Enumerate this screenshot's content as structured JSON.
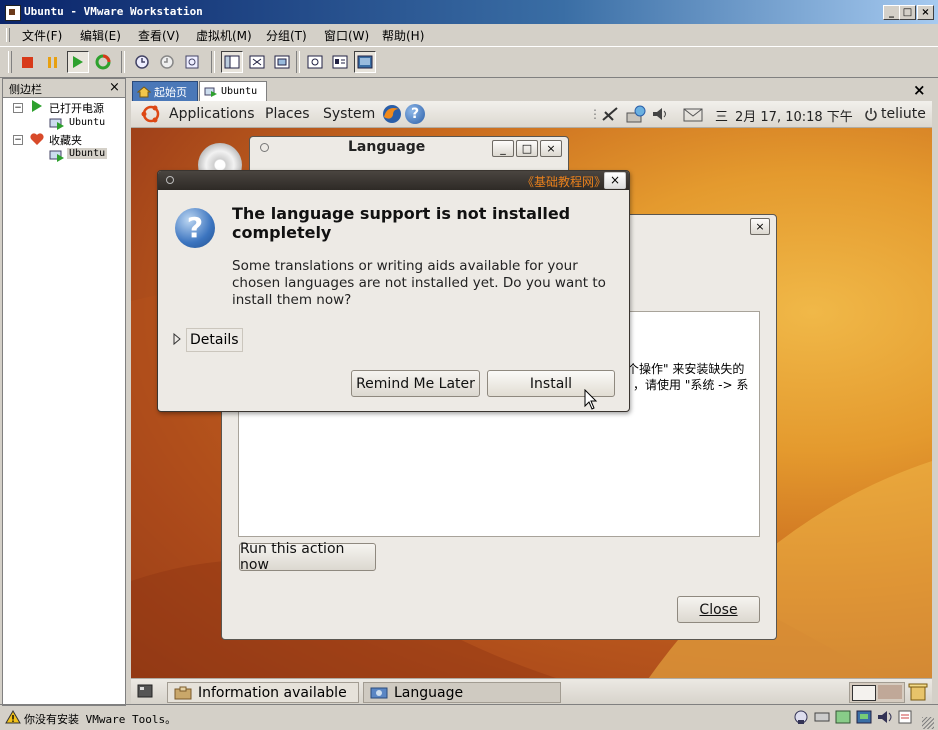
{
  "window": {
    "title": "Ubuntu - VMware Workstation",
    "min": "_",
    "max": "□",
    "close": "×"
  },
  "menu": [
    {
      "label": "文件(F)"
    },
    {
      "label": "编辑(E)"
    },
    {
      "label": "查看(V)"
    },
    {
      "label": "虚拟机(M)"
    },
    {
      "label": "分组(T)"
    },
    {
      "label": "窗口(W)"
    },
    {
      "label": "帮助(H)"
    }
  ],
  "sidebar": {
    "title": "侧边栏",
    "close": "×",
    "groups": [
      {
        "label": "已打开电源",
        "child": "Ubuntu"
      },
      {
        "label": "收藏夹",
        "child": "Ubuntu"
      }
    ]
  },
  "tabs": [
    {
      "label": "起始页"
    },
    {
      "label": "Ubuntu"
    }
  ],
  "tabs_close": "×",
  "guest": {
    "panel": {
      "applications": "Applications",
      "places": "Places",
      "system": "System",
      "help_glyph": "?",
      "weekday": "三",
      "datetime": "2月 17, 10:18 下午",
      "user": "teliute"
    },
    "language_window": {
      "title": "Language",
      "min": "_",
      "max": "□",
      "close": "×",
      "back_close": "×",
      "text_line1": "个操作\" 来安装缺失的",
      "text_line2": "，请使用 \"系统 -> 系",
      "run_button": "Run this action now",
      "close_button": "Close"
    },
    "alert": {
      "watermark": "《基础教程网》",
      "close": "×",
      "icon_glyph": "?",
      "heading": "The language support is not installed completely",
      "body": "Some translations or writing aids available for your chosen languages are not installed yet. Do you want to install them now?",
      "details": "Details",
      "remind_button": "Remind Me Later",
      "install_button": "Install"
    },
    "taskbar": [
      {
        "label": "Information available"
      },
      {
        "label": "Language"
      }
    ]
  },
  "status": {
    "message": "你没有安装 VMware Tools。"
  },
  "colors": {
    "title_gradient_start": "#0a246a",
    "title_gradient_end": "#a6caf0",
    "vm_accent": "#e49a2e"
  }
}
